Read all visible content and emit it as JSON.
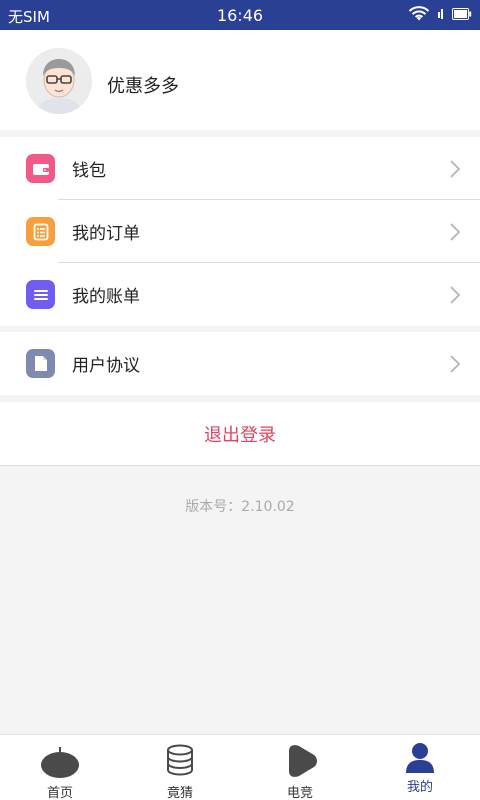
{
  "status_bar": {
    "carrier": "无SIM",
    "time": "16:46"
  },
  "profile": {
    "name": "优惠多多"
  },
  "menu": {
    "group1": [
      {
        "label": "钱包",
        "icon": "wallet-icon",
        "color": "#f25a86"
      },
      {
        "label": "我的订单",
        "icon": "order-list-icon",
        "color": "#f5a03c"
      },
      {
        "label": "我的账单",
        "icon": "bill-icon",
        "color": "#6f5cf0"
      }
    ],
    "group2": [
      {
        "label": "用户协议",
        "icon": "document-icon",
        "color": "#7e8ab0"
      }
    ]
  },
  "logout_label": "退出登录",
  "version_text": "版本号：2.10.02",
  "tabbar": {
    "tabs": [
      {
        "label": "首页",
        "icon": "home-icon"
      },
      {
        "label": "竟猜",
        "icon": "coins-icon"
      },
      {
        "label": "电竞",
        "icon": "play-icon"
      },
      {
        "label": "我的",
        "icon": "user-icon"
      }
    ],
    "active_index": 3
  },
  "colors": {
    "status_bar": "#2a4094",
    "accent": "#2a4094",
    "logout_text": "#e0455f"
  }
}
